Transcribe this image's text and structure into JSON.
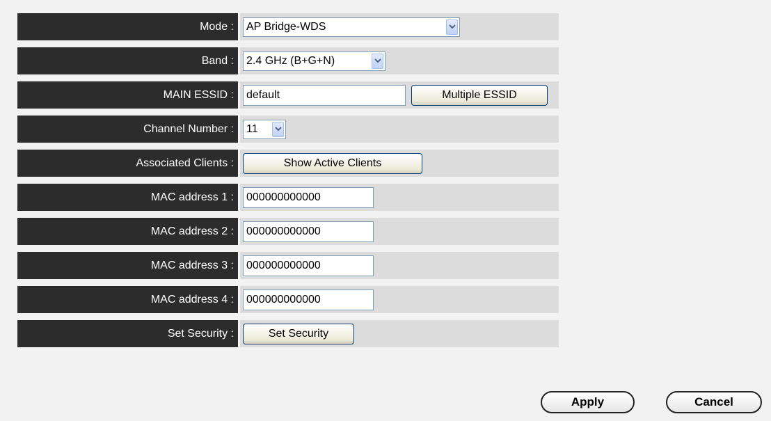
{
  "form": {
    "mode": {
      "label": "Mode :",
      "value": "AP Bridge-WDS"
    },
    "band": {
      "label": "Band :",
      "value": "2.4 GHz (B+G+N)"
    },
    "essid": {
      "label": "MAIN ESSID :",
      "value": "default",
      "button": "Multiple ESSID"
    },
    "channel": {
      "label": "Channel Number :",
      "value": "11"
    },
    "clients": {
      "label": "Associated Clients :",
      "button": "Show Active Clients"
    },
    "mac1": {
      "label": "MAC address 1 :",
      "value": "000000000000"
    },
    "mac2": {
      "label": "MAC address 2 :",
      "value": "000000000000"
    },
    "mac3": {
      "label": "MAC address 3 :",
      "value": "000000000000"
    },
    "mac4": {
      "label": "MAC address 4 :",
      "value": "000000000000"
    },
    "security": {
      "label": "Set Security :",
      "button": "Set Security"
    }
  },
  "actions": {
    "apply": "Apply",
    "cancel": "Cancel"
  },
  "icons": {
    "dropdown": "chevron-down-icon"
  },
  "colors": {
    "label_bg": "#2c2c2c",
    "value_bg": "#dcdcdc",
    "page_bg": "#f2f2f2",
    "dropdown_arrow": "#4d6185"
  }
}
